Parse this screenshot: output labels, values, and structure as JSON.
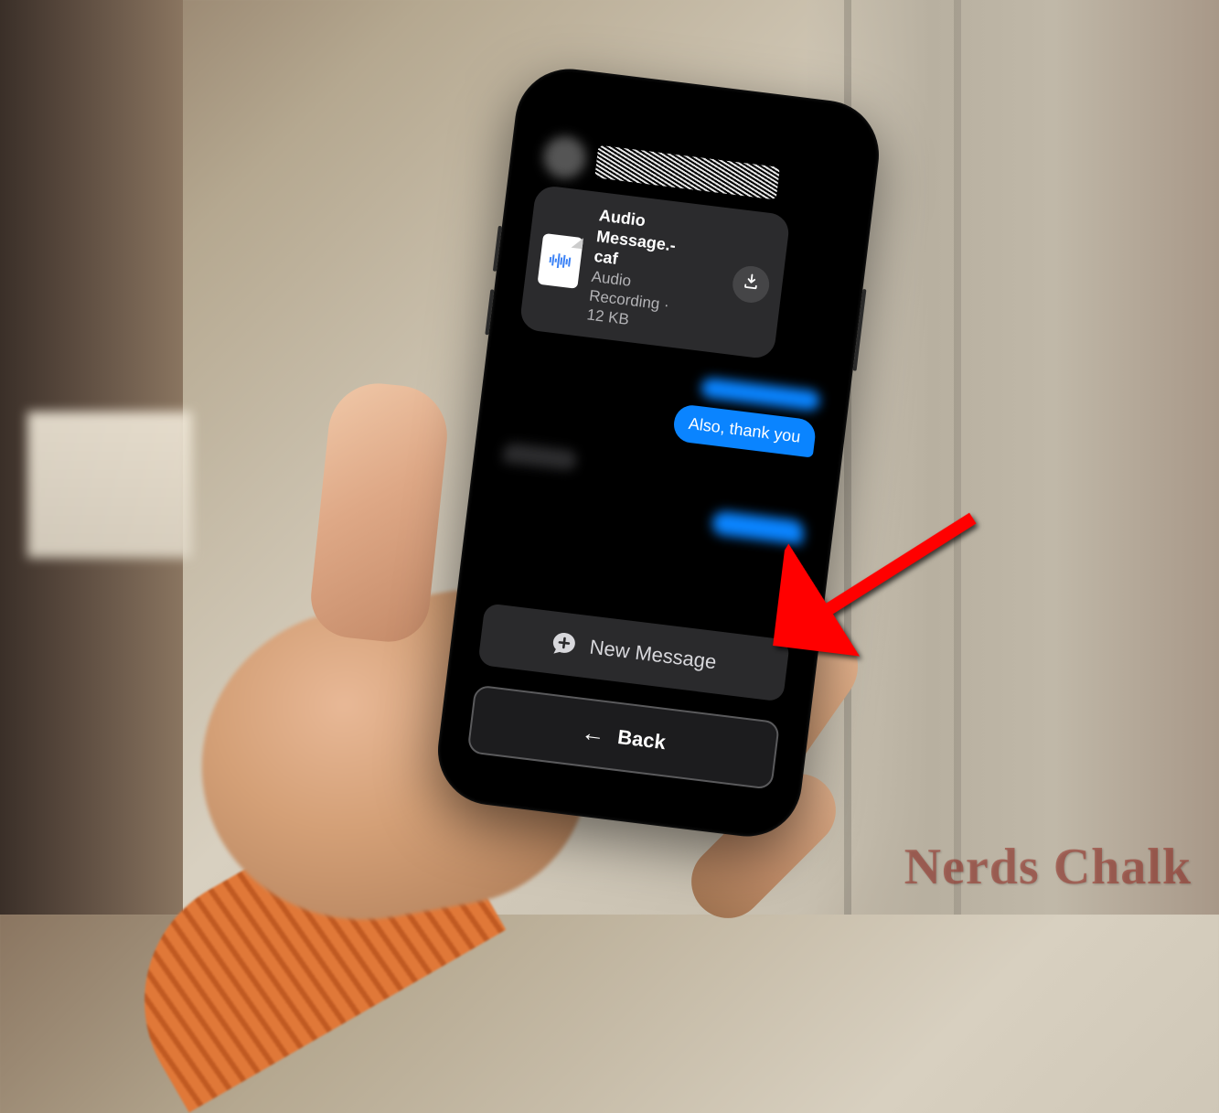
{
  "audio_attachment": {
    "title_line1": "Audio",
    "title_line2": "Message.-",
    "title_line3": "caf",
    "subtitle_line1": "Audio",
    "subtitle_line2": "Recording ·",
    "size": "12 KB"
  },
  "messages": {
    "out_thank_you": "Also, thank you"
  },
  "buttons": {
    "new_message": "New Message",
    "back": "Back"
  },
  "watermark": "Nerds Chalk",
  "colors": {
    "imessage_blue": "#0a84ff",
    "bubble_gray": "#2c2c2e",
    "arrow_red": "#ff0000"
  }
}
